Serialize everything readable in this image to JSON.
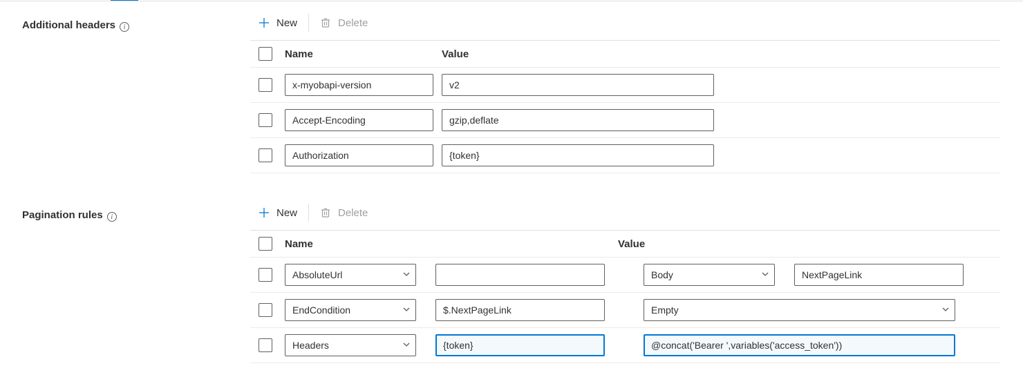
{
  "sections": {
    "additional_headers": {
      "label": "Additional headers",
      "toolbar": {
        "new": "New",
        "delete": "Delete"
      },
      "columns": {
        "name": "Name",
        "value": "Value"
      },
      "rows": [
        {
          "name": "x-myobapi-version",
          "value": "v2"
        },
        {
          "name": "Accept-Encoding",
          "value": "gzip,deflate"
        },
        {
          "name": "Authorization",
          "value": "{token}"
        }
      ]
    },
    "pagination_rules": {
      "label": "Pagination rules",
      "toolbar": {
        "new": "New",
        "delete": "Delete"
      },
      "columns": {
        "name": "Name",
        "value": "Value"
      },
      "rows": [
        {
          "name_type": "AbsoluteUrl",
          "name_extra": "",
          "value_type": "Body",
          "value_extra": "NextPageLink"
        },
        {
          "name_type": "EndCondition",
          "name_extra": "$.NextPageLink",
          "value_type": "Empty",
          "value_extra": ""
        },
        {
          "name_type": "Headers",
          "name_extra": "{token}",
          "value_expr": "@concat('Bearer ',variables('access_token'))"
        }
      ]
    }
  }
}
